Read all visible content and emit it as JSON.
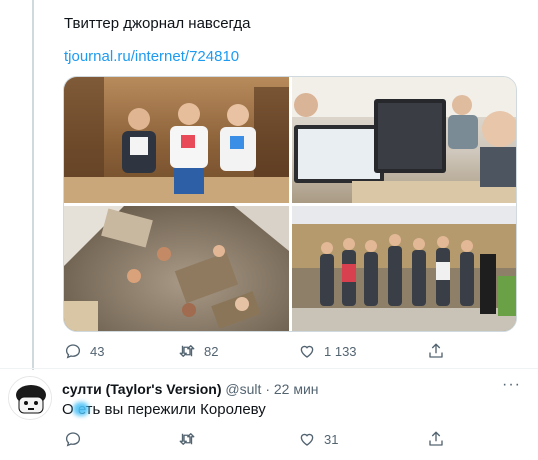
{
  "tweet1": {
    "text": "Твиттер джорнал навсегда",
    "link": "tjournal.ru/internet/724810",
    "media": [
      {
        "icon": "team-photo-lobby"
      },
      {
        "icon": "team-photo-monitors"
      },
      {
        "icon": "team-photo-office-top"
      },
      {
        "icon": "team-photo-group"
      }
    ],
    "actions": {
      "replies": "43",
      "retweets": "82",
      "likes": "1 133"
    }
  },
  "tweet2": {
    "name": "султи (Taylor's Version)",
    "handle": "@sult",
    "separator": "·",
    "time": "22 мин",
    "more": "···",
    "text": "О  еть вы пережили Королеву",
    "actions": {
      "replies": "",
      "retweets": "",
      "likes": "31"
    }
  },
  "colors": {
    "link": "#1d9bf0",
    "muted": "#536471",
    "text": "#0f1419",
    "border": "#cfd9de"
  }
}
